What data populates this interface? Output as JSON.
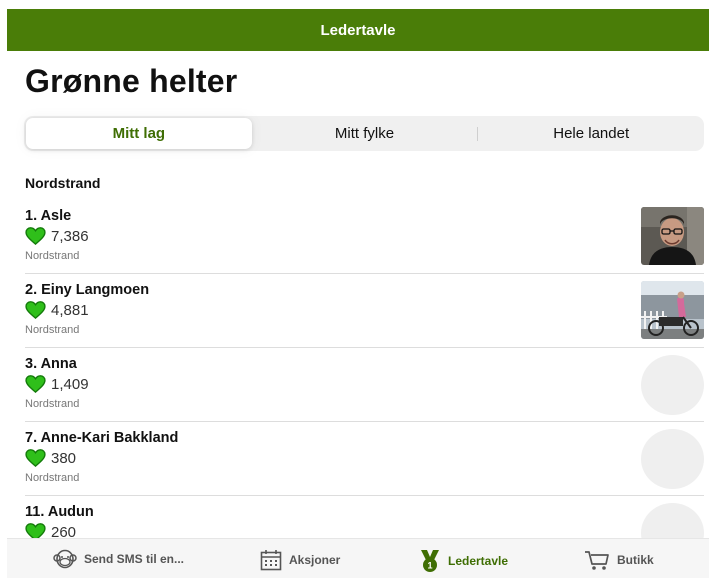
{
  "header": {
    "title": "Ledertavle"
  },
  "page": {
    "title": "Grønne helter"
  },
  "tabs": [
    {
      "label": "Mitt lag",
      "active": true
    },
    {
      "label": "Mitt fylke",
      "active": false
    },
    {
      "label": "Hele landet",
      "active": false
    }
  ],
  "section": {
    "title": "Nordstrand"
  },
  "leaderboard": [
    {
      "name": "1. Asle",
      "score": "7,386",
      "team": "Nordstrand",
      "avatar": "photo-man-glasses"
    },
    {
      "name": "2. Einy Langmoen",
      "score": "4,881",
      "team": "Nordstrand",
      "avatar": "photo-cargo-bike"
    },
    {
      "name": "3. Anna",
      "score": "1,409",
      "team": "Nordstrand",
      "avatar": "placeholder"
    },
    {
      "name": "7. Anne-Kari Bakkland",
      "score": "380",
      "team": "Nordstrand",
      "avatar": "placeholder"
    },
    {
      "name": "11. Audun",
      "score": "260",
      "team": "",
      "avatar": "placeholder"
    }
  ],
  "bottom_nav": [
    {
      "label": "Send SMS til en...",
      "icon": "monkey-icon",
      "active": false
    },
    {
      "label": "Aksjoner",
      "icon": "calendar-icon",
      "active": false
    },
    {
      "label": "Ledertavle",
      "icon": "medal-icon",
      "active": true
    },
    {
      "label": "Butikk",
      "icon": "cart-icon",
      "active": false
    }
  ],
  "colors": {
    "brand_green": "#4a7d08",
    "active_text": "#3f6e04",
    "heart_green": "#2fbf1a"
  }
}
